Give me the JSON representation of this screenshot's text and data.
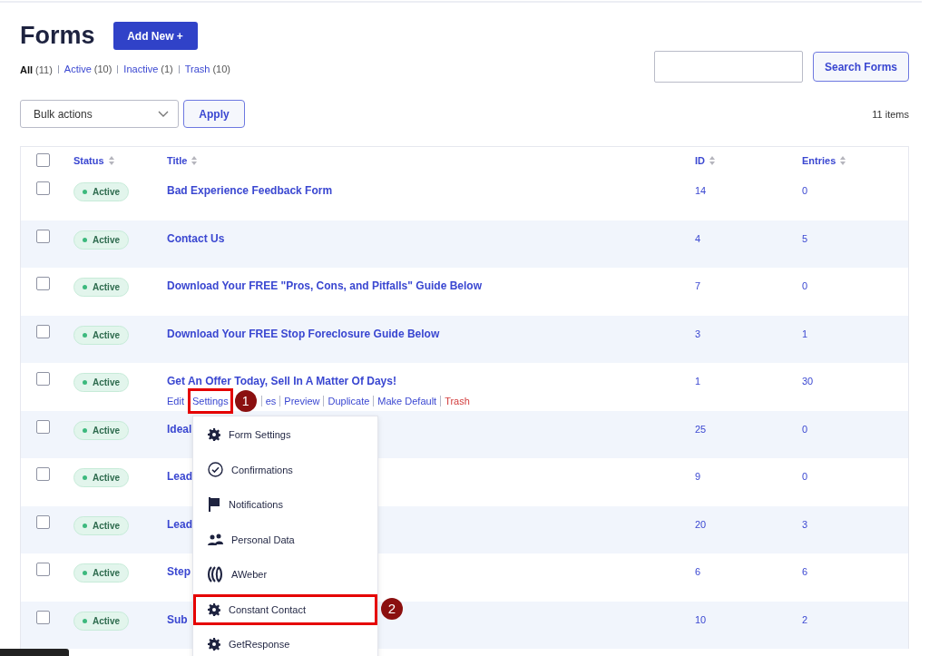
{
  "page": {
    "title": "Forms",
    "add_button": "Add New +"
  },
  "filters": [
    {
      "label": "All",
      "count": "(11)",
      "selected": true
    },
    {
      "label": "Active",
      "count": "(10)",
      "selected": false
    },
    {
      "label": "Inactive",
      "count": "(1)",
      "selected": false
    },
    {
      "label": "Trash",
      "count": "(10)",
      "selected": false
    }
  ],
  "search": {
    "button": "Search Forms"
  },
  "bulk": {
    "select": "Bulk actions",
    "apply": "Apply"
  },
  "item_count": "11 items",
  "table": {
    "select_all_checked": false,
    "columns": [
      "Status",
      "Title",
      "ID",
      "Entries"
    ],
    "rows": [
      {
        "checked": false,
        "status": "Active",
        "title": "Bad Experience Feedback Form",
        "id": "14",
        "entries": "0"
      },
      {
        "checked": false,
        "status": "Active",
        "title": "Contact Us",
        "id": "4",
        "entries": "5"
      },
      {
        "checked": false,
        "status": "Active",
        "title": "Download Your FREE \"Pros, Cons, and Pitfalls\" Guide Below",
        "id": "7",
        "entries": "0"
      },
      {
        "checked": false,
        "status": "Active",
        "title": "Download Your FREE Stop Foreclosure Guide Below",
        "id": "3",
        "entries": "1"
      },
      {
        "checked": false,
        "status": "Active",
        "title": "Get An Offer Today, Sell In A Matter Of Days!",
        "id": "1",
        "entries": "30",
        "actions": [
          {
            "label": "Edit",
            "kind": "link",
            "highlighted": false
          },
          {
            "label": "Settings",
            "kind": "link",
            "highlighted": true,
            "badge": "1"
          },
          {
            "label": "es",
            "kind": "link",
            "highlighted": false
          },
          {
            "label": "Preview",
            "kind": "link",
            "highlighted": false
          },
          {
            "label": "Duplicate",
            "kind": "link",
            "highlighted": false
          },
          {
            "label": "Make Default",
            "kind": "link",
            "highlighted": false
          },
          {
            "label": "Trash",
            "kind": "danger",
            "highlighted": false
          }
        ]
      },
      {
        "checked": false,
        "status": "Active",
        "title": "Ideal",
        "id": "25",
        "entries": "0"
      },
      {
        "checked": false,
        "status": "Active",
        "title": "Lead",
        "id": "9",
        "entries": "0"
      },
      {
        "checked": false,
        "status": "Active",
        "title": "Lead",
        "id": "20",
        "entries": "3"
      },
      {
        "checked": false,
        "status": "Active",
        "title": "Step",
        "id": "6",
        "entries": "6"
      },
      {
        "checked": false,
        "status": "Active",
        "title": "Sub",
        "id": "10",
        "entries": "2"
      }
    ]
  },
  "menu": {
    "items": [
      {
        "label": "Form Settings",
        "kind": "gear",
        "highlighted": false
      },
      {
        "label": "Confirmations",
        "kind": "check",
        "highlighted": false
      },
      {
        "label": "Notifications",
        "kind": "flag",
        "highlighted": false
      },
      {
        "label": "Personal Data",
        "kind": "people",
        "highlighted": false
      },
      {
        "label": "AWeber",
        "kind": "aweber",
        "highlighted": false
      },
      {
        "label": "Constant Contact",
        "kind": "gear",
        "highlighted": true,
        "badge": "2"
      },
      {
        "label": "GetResponse",
        "kind": "gear",
        "highlighted": false
      }
    ]
  }
}
